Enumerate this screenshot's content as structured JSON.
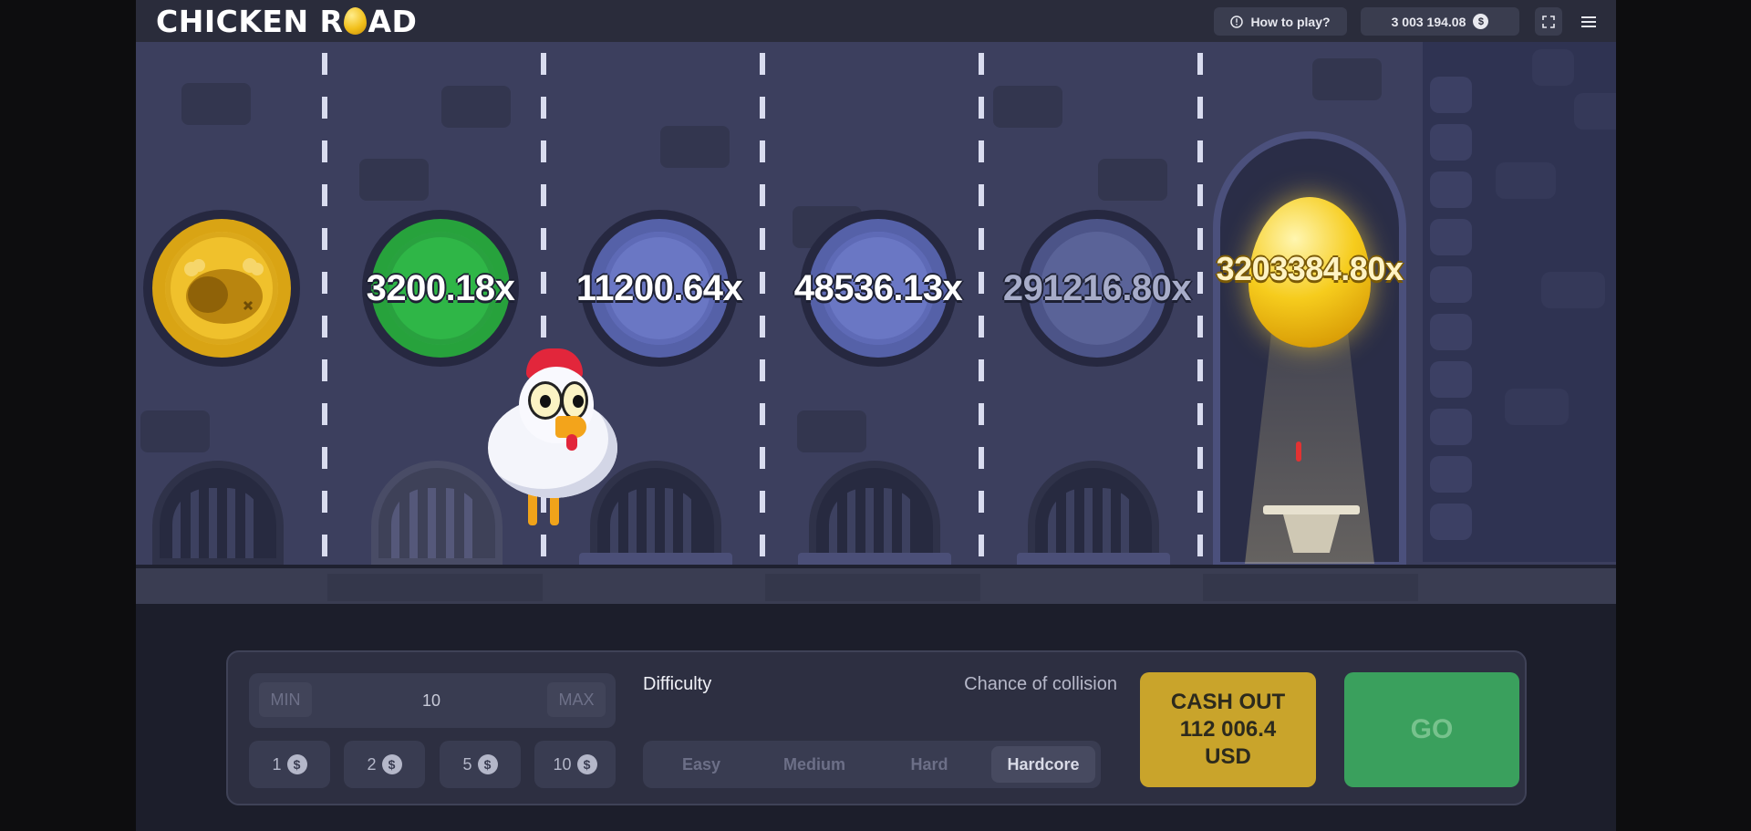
{
  "header": {
    "logo_left": "CHICKEN R",
    "logo_right": "AD",
    "how_to_play": "How to play?",
    "balance": "3 003 194.08",
    "currency_symbol": "$"
  },
  "lanes": [
    {
      "multiplier": "",
      "state": "passed",
      "coin_color": "#f0c12c"
    },
    {
      "multiplier": "3200.18x",
      "state": "current",
      "coin_color": "#2fb647"
    },
    {
      "multiplier": "11200.64x",
      "state": "upcoming",
      "coin_color": "#6a77c4"
    },
    {
      "multiplier": "48536.13x",
      "state": "upcoming",
      "coin_color": "#6a77c4"
    },
    {
      "multiplier": "291216.80x",
      "state": "locked",
      "coin_color": "#5a6398"
    },
    {
      "multiplier": "3203384.80x",
      "state": "final",
      "coin_color": "#f6cc1d"
    }
  ],
  "controls": {
    "min_label": "MIN",
    "max_label": "MAX",
    "bet_value": "10",
    "quick_bets": [
      "1",
      "2",
      "5",
      "10"
    ],
    "difficulty_label": "Difficulty",
    "collision_label": "Chance of collision",
    "difficulties": [
      "Easy",
      "Medium",
      "Hard",
      "Hardcore"
    ],
    "selected_difficulty": "Hardcore",
    "cashout": {
      "line1": "CASH OUT",
      "amount": "112 006.4",
      "currency": "USD"
    },
    "go_label": "GO"
  },
  "colors": {
    "accent_green": "#3aa05d",
    "cashout_gold": "#c9a42b",
    "panel_bg": "#2d2f41"
  }
}
